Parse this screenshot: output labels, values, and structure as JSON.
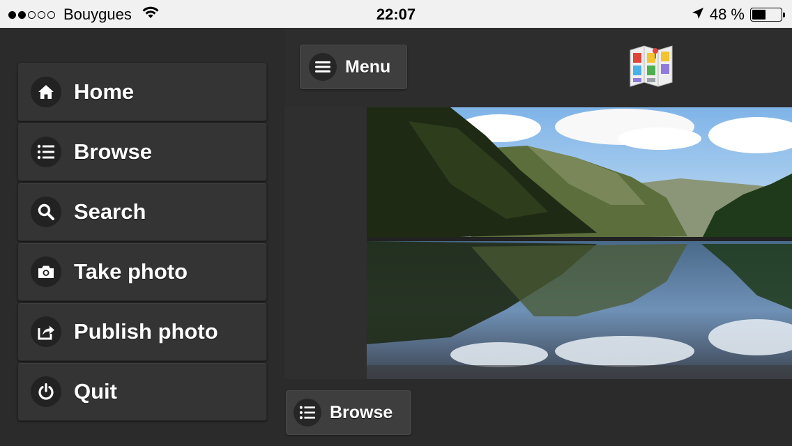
{
  "status_bar": {
    "carrier": "Bouygues",
    "time": "22:07",
    "battery_text": "48 %",
    "battery_level": 0.48,
    "signal_bars": 2,
    "signal_total": 5
  },
  "side_menu": {
    "items": [
      {
        "label": "Home",
        "icon": "home-icon"
      },
      {
        "label": "Browse",
        "icon": "list-icon"
      },
      {
        "label": "Search",
        "icon": "search-icon"
      },
      {
        "label": "Take photo",
        "icon": "camera-icon"
      },
      {
        "label": "Publish photo",
        "icon": "share-icon"
      },
      {
        "label": "Quit",
        "icon": "power-icon"
      }
    ]
  },
  "header": {
    "menu_label": "Menu",
    "menu_icon": "hamburger-icon",
    "logo_icon": "map-logo-icon"
  },
  "footer": {
    "browse_label": "Browse",
    "browse_icon": "list-icon"
  },
  "colors": {
    "menu_item_bg": "#343434",
    "icon_circle_bg": "#222222",
    "status_bar_bg": "#f1f1f1"
  }
}
